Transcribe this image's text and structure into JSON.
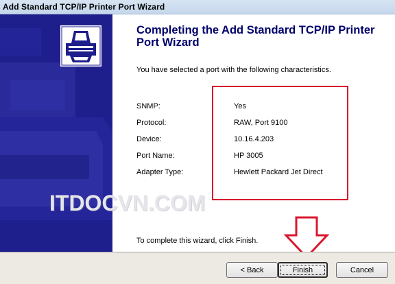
{
  "window": {
    "title": "Add Standard TCP/IP Printer Port Wizard"
  },
  "main": {
    "heading": "Completing the Add Standard TCP/IP Printer Port Wizard",
    "intro": "You have selected a port with the following characteristics.",
    "properties": [
      {
        "label": "SNMP:",
        "value": "Yes"
      },
      {
        "label": "Protocol:",
        "value": "RAW, Port 9100"
      },
      {
        "label": "Device:",
        "value": "10.16.4.203"
      },
      {
        "label": "Port Name:",
        "value": "HP 3005"
      },
      {
        "label": "Adapter Type:",
        "value": "Hewlett Packard Jet Direct"
      }
    ],
    "finish_note": "To complete this wizard, click Finish."
  },
  "watermark": "ITDOCVN.COM",
  "buttons": {
    "back": "< Back",
    "finish": "Finish",
    "cancel": "Cancel"
  },
  "colors": {
    "side_panel": "#1e1e8c",
    "heading": "#00006b",
    "annotation": "#d8182d"
  },
  "icons": [
    "printer-icon",
    "down-arrow-annotation"
  ]
}
